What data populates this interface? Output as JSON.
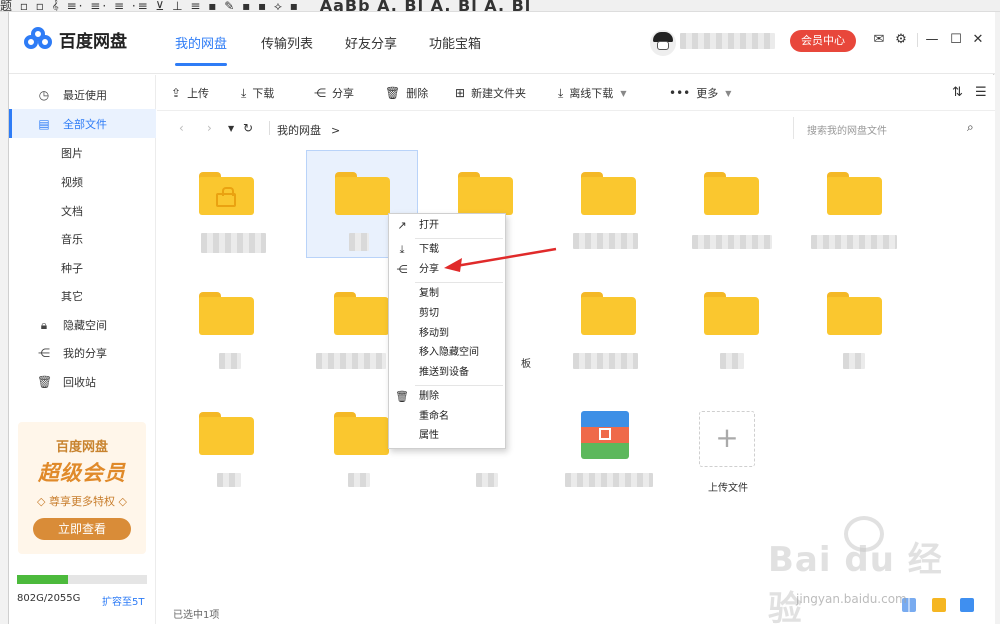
{
  "word_strip": {
    "text": "题 ▫ ▫ 𝄞 ≡· ≡· ≡ ·≡ ⊻ ⊥ ≡ ▪ ✎ ▪ ▪ ⟡ ▪",
    "big": "AaBb A. Bl A. Bl A. Bl"
  },
  "app": {
    "title": "百度网盘",
    "tabs": [
      {
        "label": "我的网盘"
      },
      {
        "label": "传输列表"
      },
      {
        "label": "好友分享"
      },
      {
        "label": "功能宝箱"
      }
    ],
    "vip_label": "会员中心"
  },
  "toolbar": {
    "upload": "上传",
    "download": "下载",
    "share": "分享",
    "delete": "删除",
    "new_folder": "新建文件夹",
    "offline_download": "离线下载",
    "more": "更多"
  },
  "path": {
    "crumb": "我的网盘",
    "crumb_sep": ">",
    "search_placeholder": "搜索我的网盘文件"
  },
  "sidebar": {
    "items": [
      {
        "label": "最近使用",
        "icon": "clock-icon"
      },
      {
        "label": "全部文件",
        "icon": "document-icon"
      },
      {
        "label": "图片"
      },
      {
        "label": "视频"
      },
      {
        "label": "文档"
      },
      {
        "label": "音乐"
      },
      {
        "label": "种子"
      },
      {
        "label": "其它"
      },
      {
        "label": "隐藏空间",
        "icon": "lock-icon"
      },
      {
        "label": "我的分享",
        "icon": "share-icon"
      },
      {
        "label": "回收站",
        "icon": "trash-icon"
      }
    ],
    "promo": {
      "title": "百度网盘",
      "slogan": "超级会员",
      "benefit": "◇ 尊享更多特权 ◇",
      "button": "立即查看"
    },
    "quota": {
      "text": "802G/2055G",
      "used_fraction": 0.39,
      "expand_link": "扩容至5T"
    }
  },
  "files": {
    "partial_label": "板",
    "upload_label": "上传文件"
  },
  "context_menu": {
    "items": [
      {
        "label": "打开",
        "icon": "open-arrow-icon"
      },
      {
        "label": "下载",
        "icon": "download-icon"
      },
      {
        "label": "分享",
        "icon": "share-icon"
      },
      {
        "label": "复制"
      },
      {
        "label": "剪切"
      },
      {
        "label": "移动到"
      },
      {
        "label": "移入隐藏空间"
      },
      {
        "label": "推送到设备"
      },
      {
        "label": "删除",
        "icon": "trash-icon"
      },
      {
        "label": "重命名"
      },
      {
        "label": "属性"
      }
    ]
  },
  "status": {
    "selected_text": "已选中1项"
  },
  "watermark": {
    "brand": "Bai du 经验",
    "url": "jingyan.baidu.com"
  },
  "colors": {
    "accent": "#2e7cf6",
    "folder": "#fac72f",
    "vip": "#e8473b",
    "quota": "#4cba3c",
    "annotation_arrow": "#e02a2a"
  }
}
